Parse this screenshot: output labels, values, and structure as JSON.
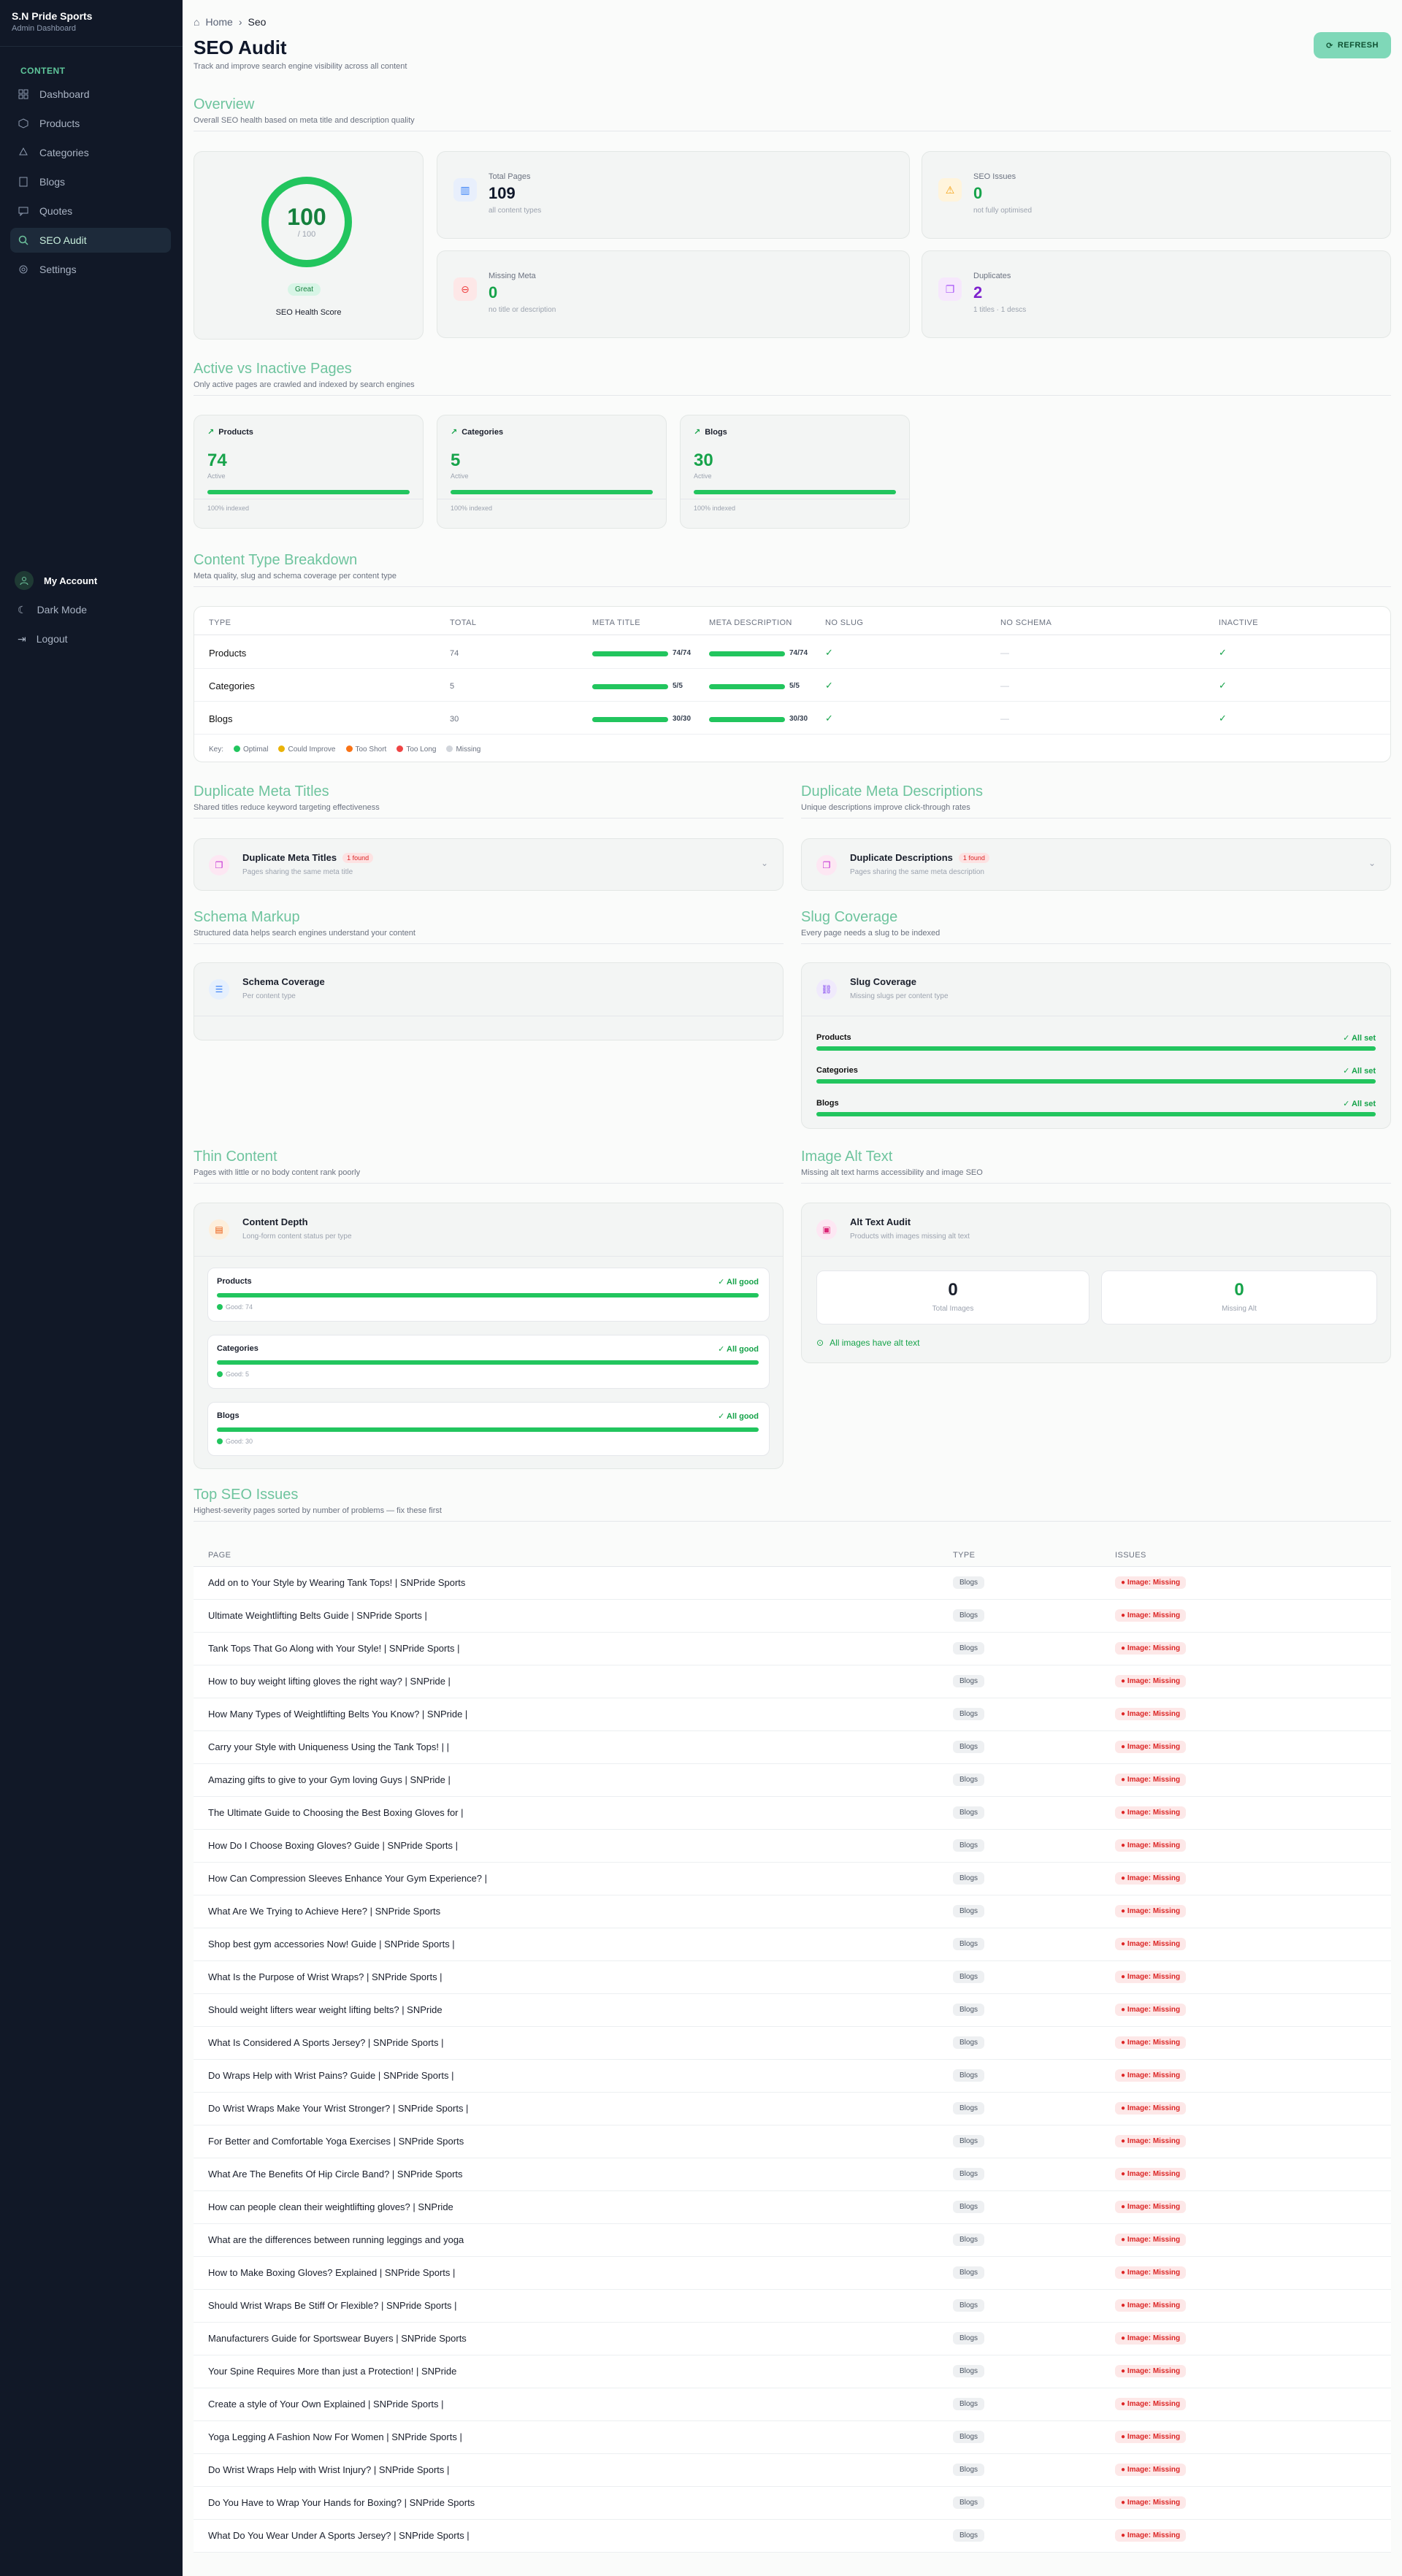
{
  "brand": {
    "name": "S.N Pride Sports",
    "subtitle": "Admin Dashboard"
  },
  "sidebar": {
    "heading": "CONTENT",
    "items": [
      {
        "label": "Dashboard"
      },
      {
        "label": "Products"
      },
      {
        "label": "Categories"
      },
      {
        "label": "Blogs"
      },
      {
        "label": "Quotes"
      },
      {
        "label": "SEO Audit"
      },
      {
        "label": "Settings"
      }
    ]
  },
  "account": {
    "my_account": "My Account",
    "dark_mode": "Dark Mode",
    "logout": "Logout"
  },
  "breadcrumb": {
    "home": "Home",
    "current": "Seo"
  },
  "page": {
    "title": "SEO Audit",
    "subtitle": "Track and improve search engine visibility across all content",
    "refresh": "REFRESH"
  },
  "overview": {
    "title": "Overview",
    "desc": "Overall SEO health based on meta title and description quality",
    "score": {
      "value": "100",
      "out_of": "/ 100",
      "badge": "Great",
      "label": "SEO Health Score"
    },
    "stats": [
      {
        "label": "Total Pages",
        "value": "109",
        "sub": "all content types"
      },
      {
        "label": "SEO Issues",
        "value": "0",
        "sub": "not fully optimised"
      },
      {
        "label": "Missing Meta",
        "value": "0",
        "sub": "no title or description"
      },
      {
        "label": "Duplicates",
        "value": "2",
        "sub": "1 titles · 1 descs"
      }
    ]
  },
  "active": {
    "title": "Active vs Inactive Pages",
    "desc": "Only active pages are crawled and indexed by search engines",
    "cards": [
      {
        "name": "Products",
        "value": "74",
        "label": "Active",
        "foot": "100% indexed"
      },
      {
        "name": "Categories",
        "value": "5",
        "label": "Active",
        "foot": "100% indexed"
      },
      {
        "name": "Blogs",
        "value": "30",
        "label": "Active",
        "foot": "100% indexed"
      }
    ]
  },
  "breakdown": {
    "title": "Content Type Breakdown",
    "desc": "Meta quality, slug and schema coverage per content type",
    "headers": [
      "TYPE",
      "TOTAL",
      "META TITLE",
      "META DESCRIPTION",
      "NO SLUG",
      "NO SCHEMA",
      "INACTIVE"
    ],
    "rows": [
      {
        "type": "Products",
        "total": "74",
        "meta_title": "74/74",
        "meta_desc": "74/74",
        "no_slug": "✓",
        "no_schema": "—",
        "inactive": "✓"
      },
      {
        "type": "Categories",
        "total": "5",
        "meta_title": "5/5",
        "meta_desc": "5/5",
        "no_slug": "✓",
        "no_schema": "—",
        "inactive": "✓"
      },
      {
        "type": "Blogs",
        "total": "30",
        "meta_title": "30/30",
        "meta_desc": "30/30",
        "no_slug": "✓",
        "no_schema": "—",
        "inactive": "✓"
      }
    ],
    "key_label": "Key:",
    "key": [
      {
        "label": "Optimal",
        "color": "#22c55e"
      },
      {
        "label": "Could Improve",
        "color": "#eab308"
      },
      {
        "label": "Too Short",
        "color": "#f97316"
      },
      {
        "label": "Too Long",
        "color": "#ef4444"
      },
      {
        "label": "Missing",
        "color": "#d1d5db"
      }
    ]
  },
  "dup_titles": {
    "title": "Duplicate Meta Titles",
    "desc": "Shared titles reduce keyword targeting effectiveness",
    "card_title": "Duplicate Meta Titles",
    "badge": "1 found",
    "card_sub": "Pages sharing the same meta title"
  },
  "dup_descs": {
    "title": "Duplicate Meta Descriptions",
    "desc": "Unique descriptions improve click-through rates",
    "card_title": "Duplicate Descriptions",
    "badge": "1 found",
    "card_sub": "Pages sharing the same meta description"
  },
  "schema": {
    "title": "Schema Markup",
    "desc": "Structured data helps search engines understand your content",
    "card_title": "Schema Coverage",
    "card_sub": "Per content type"
  },
  "slug": {
    "title": "Slug Coverage",
    "desc": "Every page needs a slug to be indexed",
    "card_title": "Slug Coverage",
    "card_sub": "Missing slugs per content type",
    "rows": [
      {
        "name": "Products",
        "status": "✓ All set",
        "fill": 1
      },
      {
        "name": "Categories",
        "status": "✓ All set",
        "fill": 1
      },
      {
        "name": "Blogs",
        "status": "✓ All set",
        "fill": 1
      }
    ]
  },
  "thin": {
    "title": "Thin Content",
    "desc": "Pages with little or no body content rank poorly",
    "card_title": "Content Depth",
    "card_sub": "Long-form content status per type",
    "rows": [
      {
        "name": "Products",
        "status": "✓ All good",
        "good": "Good: 74",
        "fill": 1
      },
      {
        "name": "Categories",
        "status": "✓ All good",
        "good": "Good: 5",
        "fill": 1
      },
      {
        "name": "Blogs",
        "status": "✓ All good",
        "good": "Good: 30",
        "fill": 1
      }
    ]
  },
  "alt": {
    "title": "Image Alt Text",
    "desc": "Missing alt text harms accessibility and image SEO",
    "card_title": "Alt Text Audit",
    "card_sub": "Products with images missing alt text",
    "total_images": "0",
    "total_label": "Total Images",
    "missing": "0",
    "missing_label": "Missing Alt",
    "ok": "All images have alt text"
  },
  "top": {
    "title": "Top SEO Issues",
    "desc": "Highest-severity pages sorted by number of problems — fix these first",
    "headers": [
      "PAGE",
      "TYPE",
      "ISSUES"
    ],
    "rows": [
      {
        "page": "Add on to Your Style by Wearing Tank Tops! | SNPride Sports",
        "type": "Blogs",
        "issue": "Image: Missing"
      },
      {
        "page": "Ultimate Weightlifting Belts Guide | SNPride Sports |",
        "type": "Blogs",
        "issue": "Image: Missing"
      },
      {
        "page": "Tank Tops That Go Along with Your Style! | SNPride Sports |",
        "type": "Blogs",
        "issue": "Image: Missing"
      },
      {
        "page": "How to buy weight lifting gloves the right way? | SNPride |",
        "type": "Blogs",
        "issue": "Image: Missing"
      },
      {
        "page": "How Many Types of Weightlifting Belts You Know? | SNPride |",
        "type": "Blogs",
        "issue": "Image: Missing"
      },
      {
        "page": "Carry your Style with Uniqueness Using the Tank Tops! | |",
        "type": "Blogs",
        "issue": "Image: Missing"
      },
      {
        "page": "Amazing gifts to give to your Gym loving Guys | SNPride |",
        "type": "Blogs",
        "issue": "Image: Missing"
      },
      {
        "page": "The Ultimate Guide to Choosing the Best Boxing Gloves for |",
        "type": "Blogs",
        "issue": "Image: Missing"
      },
      {
        "page": "How Do I Choose Boxing Gloves? Guide | SNPride Sports |",
        "type": "Blogs",
        "issue": "Image: Missing"
      },
      {
        "page": "How Can Compression Sleeves Enhance Your Gym Experience? |",
        "type": "Blogs",
        "issue": "Image: Missing"
      },
      {
        "page": "What Are We Trying to Achieve Here? | SNPride Sports",
        "type": "Blogs",
        "issue": "Image: Missing"
      },
      {
        "page": "Shop best gym accessories Now! Guide | SNPride Sports |",
        "type": "Blogs",
        "issue": "Image: Missing"
      },
      {
        "page": "What Is the Purpose of Wrist Wraps? | SNPride Sports |",
        "type": "Blogs",
        "issue": "Image: Missing"
      },
      {
        "page": "Should weight lifters wear weight lifting belts? | SNPride",
        "type": "Blogs",
        "issue": "Image: Missing"
      },
      {
        "page": "What Is Considered A Sports Jersey? | SNPride Sports |",
        "type": "Blogs",
        "issue": "Image: Missing"
      },
      {
        "page": "Do Wraps Help with Wrist Pains? Guide | SNPride Sports |",
        "type": "Blogs",
        "issue": "Image: Missing"
      },
      {
        "page": "Do Wrist Wraps Make Your Wrist Stronger? | SNPride Sports |",
        "type": "Blogs",
        "issue": "Image: Missing"
      },
      {
        "page": "For Better and Comfortable Yoga Exercises | SNPride Sports",
        "type": "Blogs",
        "issue": "Image: Missing"
      },
      {
        "page": "What Are The Benefits Of Hip Circle Band? | SNPride Sports",
        "type": "Blogs",
        "issue": "Image: Missing"
      },
      {
        "page": "How can people clean their weightlifting gloves? | SNPride",
        "type": "Blogs",
        "issue": "Image: Missing"
      },
      {
        "page": "What are the differences between running leggings and yoga",
        "type": "Blogs",
        "issue": "Image: Missing"
      },
      {
        "page": "How to Make Boxing Gloves? Explained | SNPride Sports |",
        "type": "Blogs",
        "issue": "Image: Missing"
      },
      {
        "page": "Should Wrist Wraps Be Stiff Or Flexible? | SNPride Sports |",
        "type": "Blogs",
        "issue": "Image: Missing"
      },
      {
        "page": "Manufacturers Guide for Sportswear Buyers | SNPride Sports",
        "type": "Blogs",
        "issue": "Image: Missing"
      },
      {
        "page": "Your Spine Requires More than just a Protection! | SNPride",
        "type": "Blogs",
        "issue": "Image: Missing"
      },
      {
        "page": "Create a style of Your Own Explained | SNPride Sports |",
        "type": "Blogs",
        "issue": "Image: Missing"
      },
      {
        "page": "Yoga Legging A Fashion Now For Women | SNPride Sports |",
        "type": "Blogs",
        "issue": "Image: Missing"
      },
      {
        "page": "Do Wrist Wraps Help with Wrist Injury? | SNPride Sports |",
        "type": "Blogs",
        "issue": "Image: Missing"
      },
      {
        "page": "Do You Have to Wrap Your Hands for Boxing? | SNPride Sports",
        "type": "Blogs",
        "issue": "Image: Missing"
      },
      {
        "page": "What Do You Wear Under A Sports Jersey? | SNPride Sports |",
        "type": "Blogs",
        "issue": "Image: Missing"
      }
    ]
  },
  "colors": {
    "accent": "#6ec49e",
    "sidebar_bg": "#111827",
    "success": "#22c55e",
    "danger": "#dc2626"
  }
}
